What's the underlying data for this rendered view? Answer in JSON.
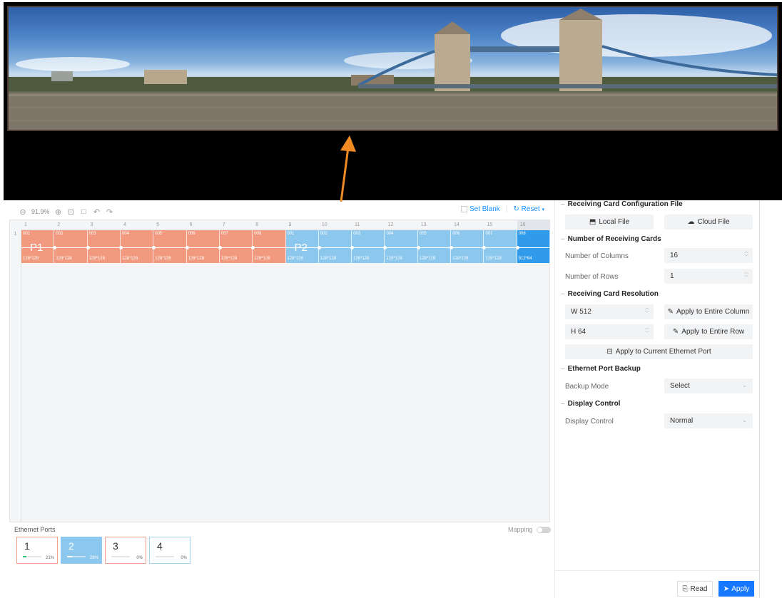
{
  "toolbar": {
    "zoom": "91.9%",
    "set_blank": "Set Blank",
    "reset": "Reset"
  },
  "canvas": {
    "columns": [
      "1",
      "2",
      "3",
      "4",
      "5",
      "6",
      "7",
      "8",
      "9",
      "10",
      "11",
      "12",
      "13",
      "14",
      "15",
      "16"
    ],
    "rows": [
      "1"
    ],
    "cells": [
      {
        "id": "001",
        "res": "128*128",
        "port": "P1"
      },
      {
        "id": "002",
        "res": "128*128",
        "port": "P1"
      },
      {
        "id": "003",
        "res": "128*128",
        "port": "P1"
      },
      {
        "id": "004",
        "res": "128*128",
        "port": "P1"
      },
      {
        "id": "005",
        "res": "128*128",
        "port": "P1"
      },
      {
        "id": "006",
        "res": "128*128",
        "port": "P1"
      },
      {
        "id": "007",
        "res": "128*128",
        "port": "P1"
      },
      {
        "id": "008",
        "res": "128*128",
        "port": "P1"
      },
      {
        "id": "001",
        "res": "128*128",
        "port": "P2"
      },
      {
        "id": "002",
        "res": "128*128",
        "port": "P2"
      },
      {
        "id": "003",
        "res": "128*128",
        "port": "P2"
      },
      {
        "id": "004",
        "res": "128*128",
        "port": "P2"
      },
      {
        "id": "005",
        "res": "128*128",
        "port": "P2"
      },
      {
        "id": "006",
        "res": "128*128",
        "port": "P2"
      },
      {
        "id": "007",
        "res": "128*128",
        "port": "P2"
      },
      {
        "id": "008",
        "res": "512*64",
        "port": "P2"
      }
    ],
    "port_labels": [
      "P1",
      "P2"
    ]
  },
  "ethernet": {
    "title": "Ethernet Ports",
    "mapping_label": "Mapping",
    "ports": [
      {
        "num": "1",
        "pct": "21%",
        "fill": 0.21
      },
      {
        "num": "2",
        "pct": "28%",
        "fill": 0.28
      },
      {
        "num": "3",
        "pct": "0%",
        "fill": 0
      },
      {
        "num": "4",
        "pct": "0%",
        "fill": 0
      }
    ]
  },
  "panel": {
    "config_title": "Receiving Card Configuration File",
    "local_file": "Local File",
    "cloud_file": "Cloud File",
    "count_title": "Number of Receiving Cards",
    "columns_label": "Number of Columns",
    "columns_value": "16",
    "rows_label": "Number of Rows",
    "rows_value": "1",
    "res_title": "Receiving Card Resolution",
    "width_value": "W 512",
    "height_value": "H 64",
    "apply_column": "Apply to Entire Column",
    "apply_row": "Apply to Entire Row",
    "apply_port": "Apply to Current Ethernet Port",
    "backup_title": "Ethernet Port Backup",
    "backup_label": "Backup Mode",
    "backup_value": "Select",
    "display_title": "Display Control",
    "display_label": "Display Control",
    "display_value": "Normal",
    "read": "Read",
    "apply": "Apply"
  },
  "colors": {
    "p1": "#f29a7f",
    "p2": "#8cc8ee",
    "selected": "#2f9bea",
    "accent": "#1677ff",
    "arrow": "#f08a24"
  }
}
